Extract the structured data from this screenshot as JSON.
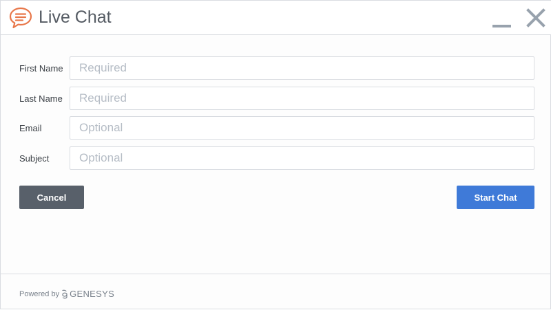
{
  "header": {
    "title": "Live Chat",
    "icon": "chat-bubble-icon",
    "minimize_icon": "minimize-icon",
    "close_icon": "close-icon",
    "accent_color": "#e8774a"
  },
  "form": {
    "fields": [
      {
        "label": "First Name",
        "placeholder": "Required",
        "value": ""
      },
      {
        "label": "Last Name",
        "placeholder": "Required",
        "value": ""
      },
      {
        "label": "Email",
        "placeholder": "Optional",
        "value": ""
      },
      {
        "label": "Subject",
        "placeholder": "Optional",
        "value": ""
      }
    ]
  },
  "actions": {
    "cancel_label": "Cancel",
    "start_label": "Start Chat",
    "cancel_color": "#58606a",
    "start_color": "#3f7ad8"
  },
  "footer": {
    "powered_by": "Powered by",
    "brand": "GENESYS",
    "brand_icon": "genesys-logo-icon"
  }
}
